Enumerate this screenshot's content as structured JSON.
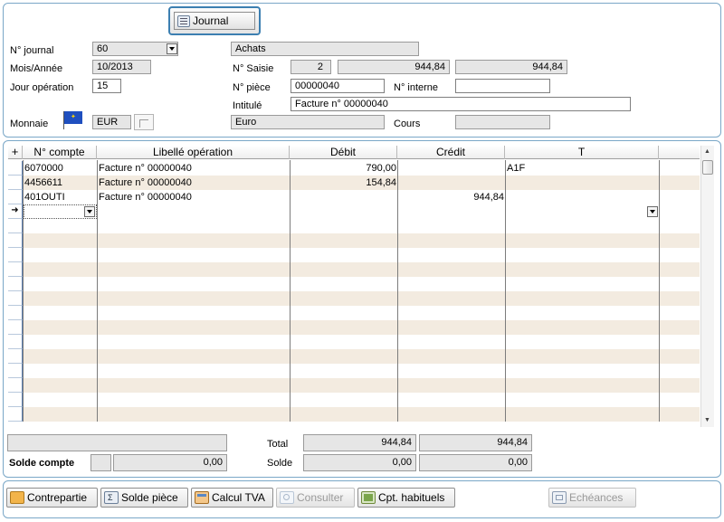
{
  "toolbar": {
    "journal_button": "Journal"
  },
  "header": {
    "journal_no_label": "N° journal",
    "journal_no_value": "60",
    "journal_name": "Achats",
    "period_label": "Mois/Année",
    "period_value": "10/2013",
    "saisie_label": "N° Saisie",
    "saisie_value": "2",
    "saisie_total_1": "944,84",
    "saisie_total_2": "944,84",
    "day_label": "Jour opération",
    "day_value": "15",
    "piece_label": "N° pièce",
    "piece_value": "00000040",
    "internal_label": "N° interne",
    "internal_value": "",
    "intitule_label": "Intitulé",
    "intitule_value": "Facture n° 00000040",
    "currency_label": "Monnaie",
    "currency_code": "EUR",
    "currency_name": "Euro",
    "rate_label": "Cours",
    "rate_value": ""
  },
  "grid": {
    "plus_header": "+",
    "columns": [
      "N° compte",
      "Libellé opération",
      "Débit",
      "Crédit",
      "T"
    ],
    "rows": [
      {
        "account": "6070000",
        "label": "Facture n° 00000040",
        "debit": "790,00",
        "credit": "",
        "t": "A1F"
      },
      {
        "account": "4456611",
        "label": "Facture n° 00000040",
        "debit": "154,84",
        "credit": "",
        "t": ""
      },
      {
        "account": "401OUTI",
        "label": "Facture n° 00000040",
        "debit": "",
        "credit": "944,84",
        "t": ""
      }
    ]
  },
  "totals": {
    "total_label": "Total",
    "total_debit": "944,84",
    "total_credit": "944,84",
    "solde_compte_label": "Solde compte",
    "solde_compte_value": "0,00",
    "solde_label": "Solde",
    "solde_debit": "0,00",
    "solde_credit": "0,00"
  },
  "actions": {
    "contrepartie": "Contrepartie",
    "solde_piece": "Solde pièce",
    "calcul_tva": "Calcul TVA",
    "consulter": "Consulter",
    "cpt_habituels": "Cpt. habituels",
    "echeances": "Echéances"
  },
  "colors": {
    "panel_border": "#7aa7c7",
    "row_stripe": "#f3ebe0",
    "field_bg": "#e6e6e6"
  }
}
